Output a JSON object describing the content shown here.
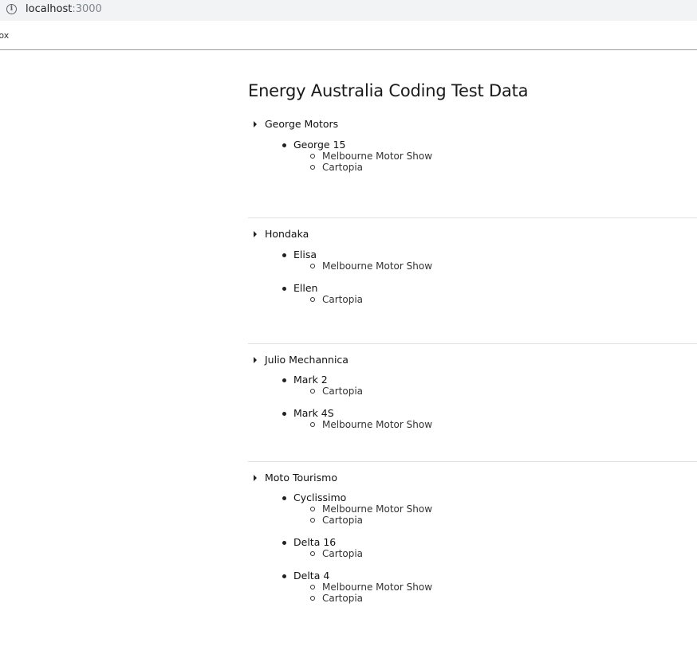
{
  "browser": {
    "address_host": "localhost",
    "address_port": ":3000",
    "bookmark_label": "tox"
  },
  "page": {
    "title": "Energy Australia Coding Test Data"
  },
  "makes": [
    {
      "name": "George Motors",
      "models": [
        {
          "name": "George 15",
          "shows": [
            "Melbourne Motor Show",
            "Cartopia"
          ]
        }
      ]
    },
    {
      "name": "Hondaka",
      "models": [
        {
          "name": "Elisa",
          "shows": [
            "Melbourne Motor Show"
          ]
        },
        {
          "name": "Ellen",
          "shows": [
            "Cartopia"
          ]
        }
      ]
    },
    {
      "name": "Julio Mechannica",
      "models": [
        {
          "name": "Mark 2",
          "shows": [
            "Cartopia"
          ]
        },
        {
          "name": "Mark 4S",
          "shows": [
            "Melbourne Motor Show"
          ]
        }
      ]
    },
    {
      "name": "Moto Tourismo",
      "models": [
        {
          "name": "Cyclissimo",
          "shows": [
            "Melbourne Motor Show",
            "Cartopia"
          ]
        },
        {
          "name": "Delta 16",
          "shows": [
            "Cartopia"
          ]
        },
        {
          "name": "Delta 4",
          "shows": [
            "Melbourne Motor Show",
            "Cartopia"
          ]
        }
      ]
    }
  ]
}
